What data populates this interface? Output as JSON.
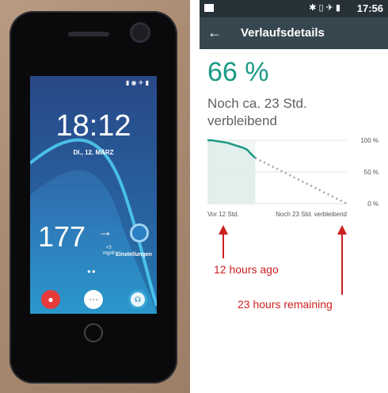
{
  "phone": {
    "status_icons": "▮ ◉ ✈ ▮",
    "clock": "18:12",
    "date": "DI., 12. MÄRZ",
    "glucose_value": "177",
    "glucose_arrow": "→",
    "glucose_delta": "+3",
    "glucose_unit": "mg/dl",
    "settings_label": "Einstellungen",
    "page_dots": "●●",
    "icons": [
      "drop-icon",
      "apps-grid-icon",
      "glucose-app-icon",
      "gear-icon"
    ]
  },
  "statusbar": {
    "icons": "✱ ▯ ✈ ▮",
    "time": "17:56",
    "background": "#263238"
  },
  "appbar": {
    "back_icon": "←",
    "title": "Verlaufsdetails",
    "background": "#37474f"
  },
  "battery": {
    "percent_text": "66 %",
    "remaining_text": "Noch ca. 23 Std. verbleibend",
    "accent_color": "#1a9a86"
  },
  "chart_data": {
    "type": "line",
    "ylim": [
      0,
      100
    ],
    "y_tick_labels": [
      "100 %",
      "50 %",
      "0 %"
    ],
    "x_labels": [
      "Vor 12 Std.",
      "Noch 23 Std. verbleibend"
    ],
    "series": [
      {
        "style": "solid",
        "color": "#1a9a86",
        "x": [
          0,
          1,
          2,
          3,
          4,
          5,
          6,
          7,
          8,
          9,
          10,
          11,
          12
        ],
        "y": [
          100,
          100,
          99,
          98,
          97,
          96,
          94,
          92,
          90,
          88,
          85,
          78,
          72
        ]
      },
      {
        "style": "dotted",
        "color": "#9aa5a8",
        "x": [
          12,
          35
        ],
        "y": [
          72,
          0
        ]
      }
    ],
    "xlim": [
      0,
      35
    ],
    "grid": true
  },
  "annotations": {
    "label_left": "12 hours ago",
    "label_right": "23 hours remaining",
    "color": "#cc1f1f"
  }
}
